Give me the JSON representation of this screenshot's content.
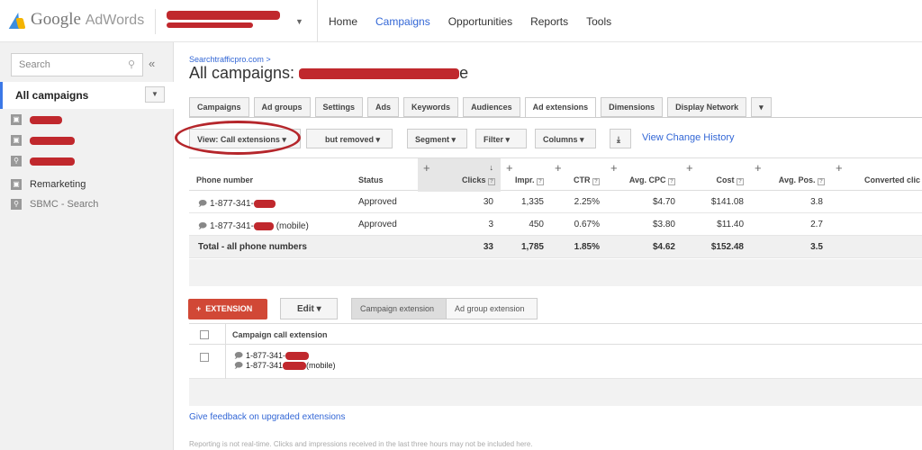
{
  "app": {
    "logo_google": "Google",
    "logo_adwords": "AdWords"
  },
  "nav": {
    "items": [
      "Home",
      "Campaigns",
      "Opportunities",
      "Reports",
      "Tools"
    ],
    "active": "Campaigns"
  },
  "sidebar": {
    "search_placeholder": "Search",
    "all_campaigns": "All campaigns",
    "items": [
      {
        "label": "Remarketing",
        "icon": "display-icon"
      },
      {
        "label": "SBMC - Search",
        "icon": "search-network-icon"
      }
    ]
  },
  "main": {
    "breadcrumb": "Searchtrafficpro.com >",
    "title": "All campaigns:",
    "title_suffix": "e",
    "tabs": [
      "Campaigns",
      "Ad groups",
      "Settings",
      "Ads",
      "Keywords",
      "Audiences",
      "Ad extensions",
      "Dimensions",
      "Display Network"
    ],
    "active_tab": "Ad extensions",
    "toolbar": {
      "view_label": "View: Call extensions",
      "filter_removed": "but removed",
      "segment": "Segment",
      "filter": "Filter",
      "columns": "Columns",
      "view_change_history": "View Change History"
    },
    "table": {
      "headers": [
        "Phone number",
        "Status",
        "Clicks",
        "Impr.",
        "CTR",
        "Avg. CPC",
        "Cost",
        "Avg. Pos.",
        "Converted clic"
      ],
      "rows": [
        {
          "phone": "1-877-341-",
          "mobile": "",
          "status": "Approved",
          "clicks": "30",
          "impr": "1,335",
          "ctr": "2.25%",
          "cpc": "$4.70",
          "cost": "$141.08",
          "pos": "3.8"
        },
        {
          "phone": "1-877-341-",
          "mobile": "(mobile)",
          "status": "Approved",
          "clicks": "3",
          "impr": "450",
          "ctr": "0.67%",
          "cpc": "$3.80",
          "cost": "$11.40",
          "pos": "2.7"
        }
      ],
      "total": {
        "label": "Total - all phone numbers",
        "clicks": "33",
        "impr": "1,785",
        "ctr": "1.85%",
        "cpc": "$4.62",
        "cost": "$152.48",
        "pos": "3.5"
      }
    },
    "extensions": {
      "add_button": "EXTENSION",
      "edit_button": "Edit",
      "seg_campaign": "Campaign extension",
      "seg_adgroup": "Ad group extension",
      "header": "Campaign call extension",
      "line1": "1-877-341-",
      "line2": "1-877-341",
      "line2_suffix": "(mobile)"
    },
    "feedback": "Give feedback on upgraded extensions",
    "footer": "Reporting is not real-time. Clicks and impressions received in the last three hours may not be included here."
  }
}
